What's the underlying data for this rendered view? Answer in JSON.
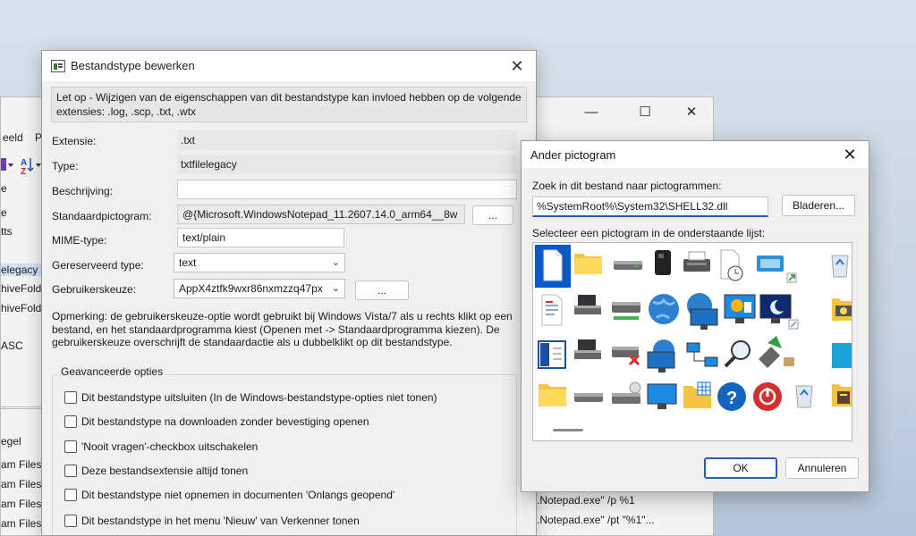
{
  "background_window": {
    "menu": [
      "eeld",
      "P"
    ],
    "left_items": [
      "e",
      "e",
      "tts",
      "elegacy",
      "hiveFold",
      "hiveFold",
      "ASC"
    ],
    "lower_items": [
      "egel",
      "am Files",
      "am Files",
      "am Files",
      "am Files"
    ],
    "right_items": [
      ".Notepad.exe\" /p %1",
      ".Notepad.exe\" /pt \"%1\"..."
    ]
  },
  "dialog": {
    "title": "Bestandstype bewerken",
    "notice": "Let op - Wijzigen van de eigenschappen van dit bestandstype kan invloed hebben op de volgende extensies: .log, .scp, .txt, .wtx",
    "fields": {
      "extension_label": "Extensie:",
      "extension_value": ".txt",
      "type_label": "Type:",
      "type_value": "txtfilelegacy",
      "description_label": "Beschrijving:",
      "description_value": "",
      "default_icon_label": "Standaardpictogram:",
      "default_icon_value": "@{Microsoft.WindowsNotepad_11.2607.14.0_arm64__8w",
      "browse_label": "...",
      "mime_label": "MIME-type:",
      "mime_value": "text/plain",
      "perceived_label": "Gereserveerd type:",
      "perceived_value": "text",
      "user_choice_label": "Gebruikerskeuze:",
      "user_choice_value": "AppX4ztfk9wxr86nxmzzq47px",
      "user_choice_button": "..."
    },
    "note": "Opmerking: de gebruikerskeuze-optie wordt gebruikt bij Windows Vista/7 als u rechts klikt op een bestand, en het standaardprogramma kiest (Openen met -> Standaardprogramma kiezen). De gebruikerskeuze overschrijft de standaardactie als u dubbelklikt op dit bestandstype.",
    "advanced_title": "Geavanceerde opties",
    "options": [
      "Dit bestandstype uitsluiten (In de Windows-bestandstype-opties niet tonen)",
      "Dit bestandstype na downloaden zonder bevestiging openen",
      "'Nooit vragen'-checkbox uitschakelen",
      "Deze bestandsextensie altijd tonen",
      "Dit bestandstype niet opnemen in documenten 'Onlangs geopend'",
      "Dit bestandstype in het menu 'Nieuw' van Verkenner tonen"
    ]
  },
  "icon_picker": {
    "title": "Ander pictogram",
    "search_label": "Zoek in dit bestand naar pictogrammen:",
    "path_value": "%SystemRoot%\\System32\\SHELL32.dll",
    "browse_button": "Bladeren...",
    "list_label": "Selecteer een pictogram in de onderstaande lijst:",
    "ok_button": "OK",
    "cancel_button": "Annuleren",
    "icons": [
      [
        "document-icon",
        "folder-icon",
        "drive-icon",
        "chip-card-icon",
        "printer-icon",
        "clock-document-icon",
        "window-shortcut-icon",
        "recycle-bin-icon"
      ],
      [
        "text-document-icon",
        "disk-drive-icon",
        "network-drive-icon",
        "globe-icon",
        "network-monitor-icon",
        "monitor-chart-icon",
        "monitor-moon-icon",
        "folder-settings-icon"
      ],
      [
        "window-list-icon",
        "drive-save-icon",
        "drive-error-icon",
        "globe-monitor-icon",
        "network-computers-icon",
        "magnifier-icon",
        "usb-drive-icon",
        "blue-panel-icon"
      ],
      [
        "folder-icon",
        "drive-icon",
        "optical-drive-icon",
        "monitor-icon",
        "folder-grid-icon",
        "help-icon",
        "power-icon",
        "recycle-bin-full-icon"
      ]
    ]
  }
}
